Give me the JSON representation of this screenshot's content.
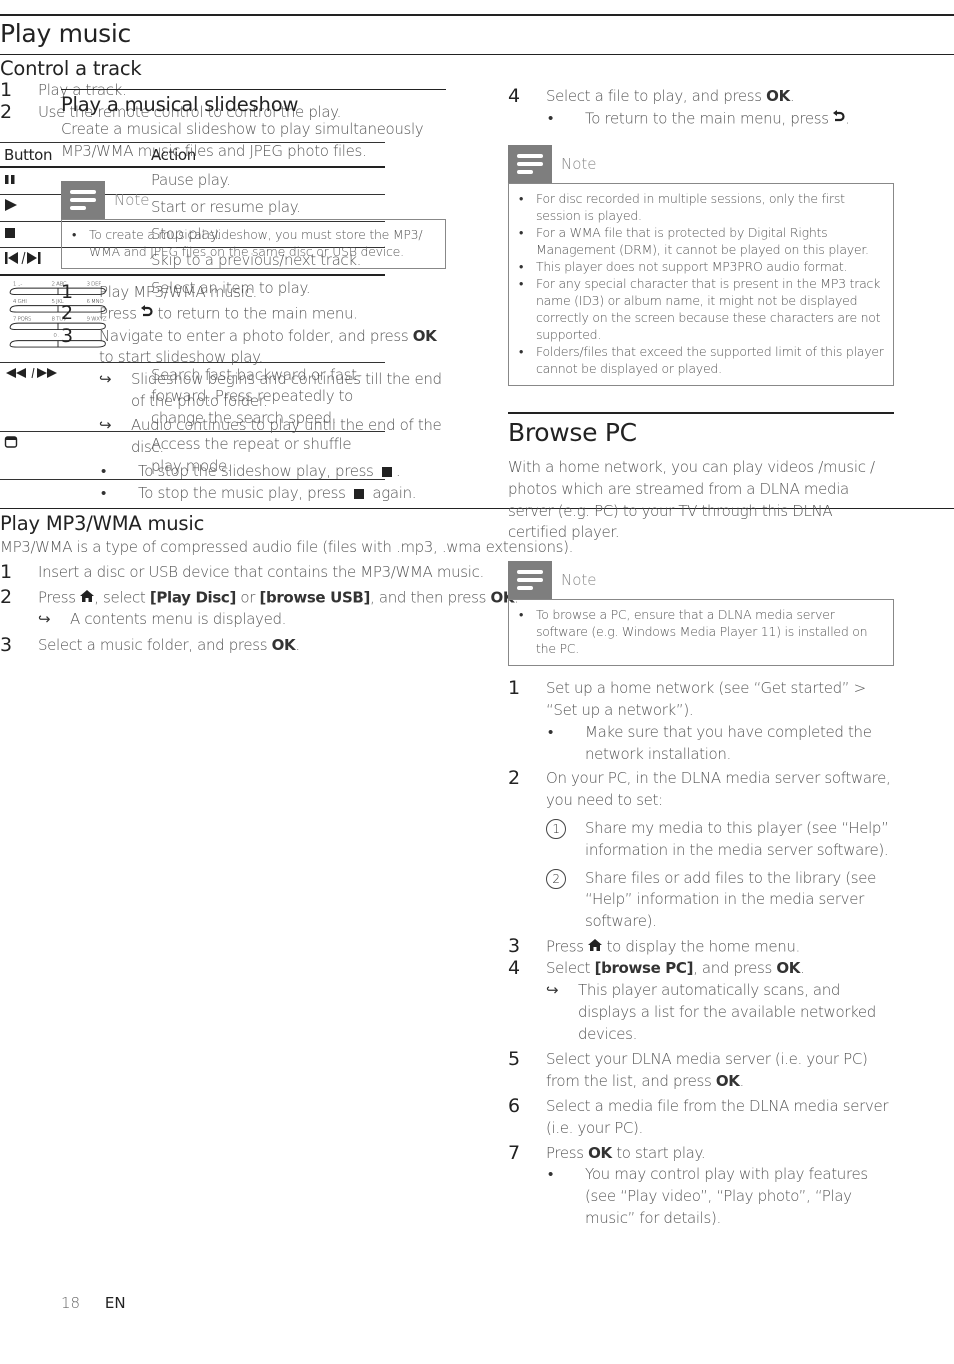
{
  "page": {
    "number": "18",
    "language": "EN"
  },
  "note_label": "Note",
  "left": {
    "slideshow": {
      "title": "Play a musical slideshow",
      "intro": "Create a musical slideshow to play simultaneously MP3/WMA music files and JPEG photo files.",
      "note": [
        "To create a musical slideshow, you must store the MP3/ WMA and JPEG files on the same disc or USB device."
      ],
      "steps": [
        {
          "num": "1",
          "text": "Play MP3/WMA music."
        },
        {
          "num": "2",
          "pre": "Press ",
          "icon": "back-icon",
          "post": " to return to the main menu."
        },
        {
          "num": "3",
          "pre": "Navigate to enter a photo folder, and press ",
          "key": "OK",
          "post": " to start slideshow play."
        }
      ],
      "results": [
        "Slideshow begins and continues till the end of the photo folder.",
        "Audio continues to play until the end of the disc."
      ],
      "bullets": [
        {
          "pre": "To stop the slideshow play, press ",
          "post": "."
        },
        {
          "pre": "To stop the music play, press ",
          "post": " again."
        }
      ]
    },
    "play_music": {
      "title": "Play music",
      "control_title": "Control a track",
      "steps": [
        {
          "num": "1",
          "text": "Play a track."
        },
        {
          "num": "2",
          "text": "Use the remote control to control the play."
        }
      ],
      "table": {
        "headers": [
          "Button",
          "Action"
        ],
        "rows": [
          {
            "icon": "pause-icon",
            "action": "Pause play."
          },
          {
            "icon": "play-icon",
            "action": "Start or resume play."
          },
          {
            "icon": "stop-icon",
            "action": "Stop play."
          },
          {
            "icon": "skip-prev-next-icon",
            "action": "Skip to a previous/next track."
          },
          {
            "icon": "numeric-keypad-icon",
            "action": "Select an item to play."
          },
          {
            "icon": "fast-backward-forward-icon",
            "action": "Search fast-backward or fast-forward. Press repeatedly to change the search speed."
          },
          {
            "icon": "repeat-shuffle-icon",
            "action": "Access the repeat or shuffle play mode."
          }
        ]
      },
      "keypad_labels": [
        "1 .,-",
        "2 ABC",
        "3 DEF",
        "4 GHI",
        "5 JKL",
        "6 MNO",
        "7 PQRS",
        "8 TUV",
        "9 WXYZ",
        "0 ."
      ]
    },
    "mp3": {
      "title": "Play MP3/WMA music",
      "intro": "MP3/WMA is a type of compressed audio file (files with .mp3, .wma extensions).",
      "step1": "Insert a disc or USB device that contains the MP3/WMA music.",
      "step2": {
        "pre": "Press ",
        "mid1": ", select ",
        "opt1": "[Play Disc]",
        "mid2": " or ",
        "opt2": "[browse USB]",
        "mid3": ", and then press ",
        "key": "OK",
        "post": "."
      },
      "step2_result": "A contents menu is displayed.",
      "step3": {
        "pre": "Select a music folder, and press ",
        "key": "OK",
        "post": "."
      }
    }
  },
  "right": {
    "mp3_cont": {
      "step4": {
        "num": "4",
        "pre": "Select a file to play, and press ",
        "key": "OK",
        "post": "."
      },
      "step4_bullet": {
        "pre": "To return to the main menu, press ",
        "post": "."
      },
      "note": [
        "For disc recorded in multiple sessions, only the first session is played.",
        "For a WMA file that is protected by Digital Rights Management (DRM), it cannot be played on this player.",
        "This player does not support MP3PRO audio format.",
        "For any special character that is present in the MP3 track name (ID3) or album name, it might not be displayed correctly on the screen because these characters are not supported.",
        "Folders/files that exceed the supported limit of this player cannot be displayed or played."
      ]
    },
    "browse_pc": {
      "title": "Browse PC",
      "intro": "With a home network, you can play videos /music / photos which are streamed from a DLNA media server (e.g. PC) to your TV through this DLNA certified player.",
      "note": [
        "To browse a PC, ensure that a DLNA media server software (e.g. Windows Media Player 11) is installed on the PC."
      ],
      "step1": "Set up a home network (see “Get started” > “Set up a network”).",
      "step1_bullet": "Make sure that you have completed the network installation.",
      "step2": "On your PC, in the DLNA media server software, you need to set:",
      "step2_subs": [
        {
          "n": "1",
          "text": "Share my media to this player (see “Help” information in the media server software)."
        },
        {
          "n": "2",
          "text": "Share files or add files to the library (see “Help” information in the media server software)."
        }
      ],
      "step3": {
        "pre": "Press ",
        "post": " to display the home menu."
      },
      "step4": {
        "pre": "Select ",
        "opt": "[browse PC]",
        "mid": ", and press ",
        "key": "OK",
        "post": "."
      },
      "step4_result": "This player automatically scans, and displays a list for the available networked devices.",
      "step5": {
        "pre": "Select your DLNA media server (i.e. your PC) from the list, and press ",
        "key": "OK",
        "post": "."
      },
      "step6": "Select a media file from the DLNA media server (i.e. your PC).",
      "step7": {
        "pre": "Press ",
        "key": "OK",
        "post": " to start play."
      },
      "step7_bullet": "You may control play with play features (see “Play video”, “Play photo”, “Play music” for details)."
    }
  }
}
